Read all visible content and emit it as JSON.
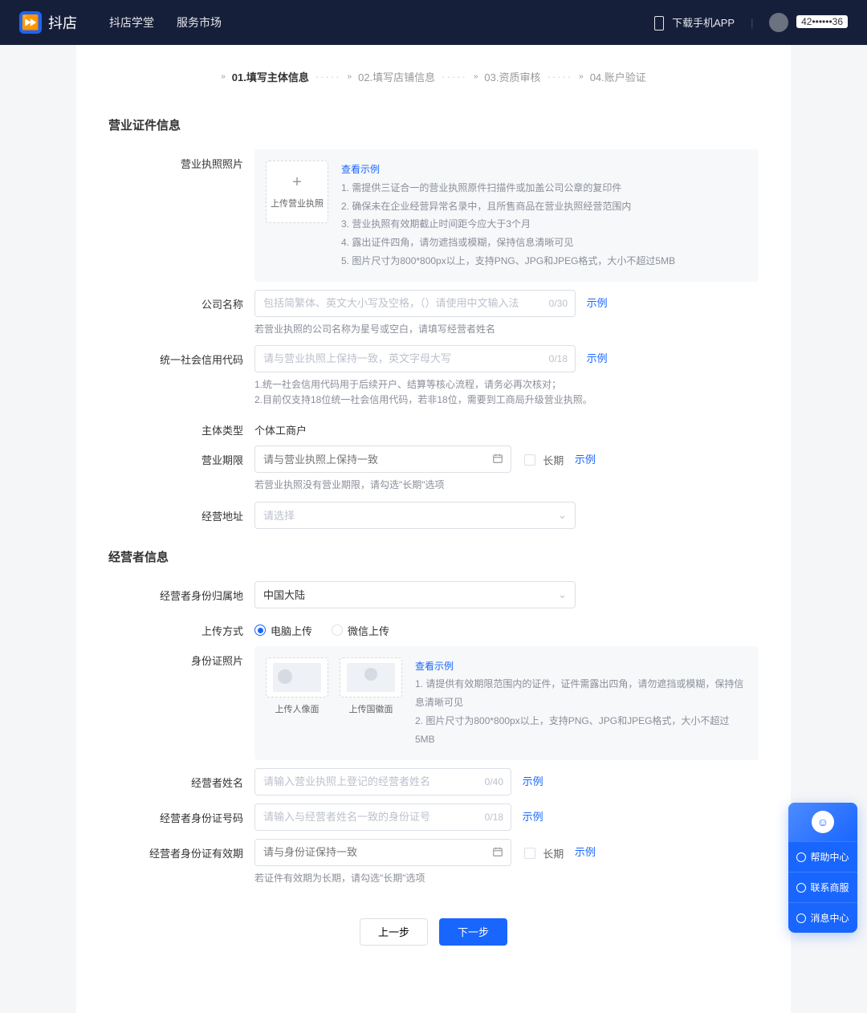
{
  "header": {
    "brand": "抖店",
    "nav": {
      "academy": "抖店学堂",
      "market": "服务市场"
    },
    "download": "下载手机APP",
    "user_masked": "42••••••36"
  },
  "steps": {
    "s1": "01.填写主体信息",
    "s2": "02.填写店铺信息",
    "s3": "03.资质审核",
    "s4": "04.账户验证"
  },
  "sections": {
    "license": "营业证件信息",
    "operator": "经营者信息"
  },
  "license": {
    "photo_label": "营业执照照片",
    "upload_text": "上传营业执照",
    "view_example": "查看示例",
    "hints": {
      "h1": "1. 需提供三证合一的营业执照原件扫描件或加盖公司公章的复印件",
      "h2": "2. 确保未在企业经营异常名录中，且所售商品在营业执照经营范围内",
      "h3": "3. 营业执照有效期截止时间距今应大于3个月",
      "h4": "4. 露出证件四角，请勿遮挡或模糊，保持信息清晰可见",
      "h5": "5. 图片尺寸为800*800px以上，支持PNG、JPG和JPEG格式，大小不超过5MB"
    },
    "company_label": "公司名称",
    "company_ph": "包括简繁体、英文大小写及空格，（）请使用中文输入法",
    "company_counter": "0/30",
    "example": "示例",
    "company_help": "若营业执照的公司名称为星号或空白，请填写经营者姓名",
    "code_label": "统一社会信用代码",
    "code_ph": "请与营业执照上保持一致，英文字母大写",
    "code_counter": "0/18",
    "code_help1": "1.统一社会信用代码用于后续开户、结算等核心流程，请务必再次核对；",
    "code_help2": "2.目前仅支持18位统一社会信用代码，若非18位，需要到工商局升级营业执照。",
    "type_label": "主体类型",
    "type_value": "个体工商户",
    "period_label": "营业期限",
    "period_ph": "请与营业执照上保持一致",
    "long_term": "长期",
    "period_help": "若营业执照没有营业期限，请勾选\"长期\"选项",
    "addr_label": "经营地址",
    "addr_ph": "请选择"
  },
  "operator": {
    "origin_label": "经营者身份归属地",
    "origin_value": "中国大陆",
    "upload_method_label": "上传方式",
    "method_pc": "电脑上传",
    "method_wx": "微信上传",
    "id_photo_label": "身份证照片",
    "upload_front": "上传人像面",
    "upload_back": "上传国徽面",
    "view_example": "查看示例",
    "id_hint1": "1. 请提供有效期限范围内的证件，证件需露出四角，请勿遮挡或模糊，保持信息清晰可见",
    "id_hint2": "2. 图片尺寸为800*800px以上，支持PNG、JPG和JPEG格式，大小不超过5MB",
    "name_label": "经营者姓名",
    "name_ph": "请输入营业执照上登记的经营者姓名",
    "name_counter": "0/40",
    "idno_label": "经营者身份证号码",
    "idno_ph": "请输入与经营者姓名一致的身份证号",
    "idno_counter": "0/18",
    "expire_label": "经营者身份证有效期",
    "expire_ph": "请与身份证保持一致",
    "expire_help": "若证件有效期为长期，请勾选\"长期\"选项"
  },
  "buttons": {
    "prev": "上一步",
    "next": "下一步"
  },
  "float": {
    "help": "帮助中心",
    "contact": "联系商服",
    "message": "消息中心"
  }
}
